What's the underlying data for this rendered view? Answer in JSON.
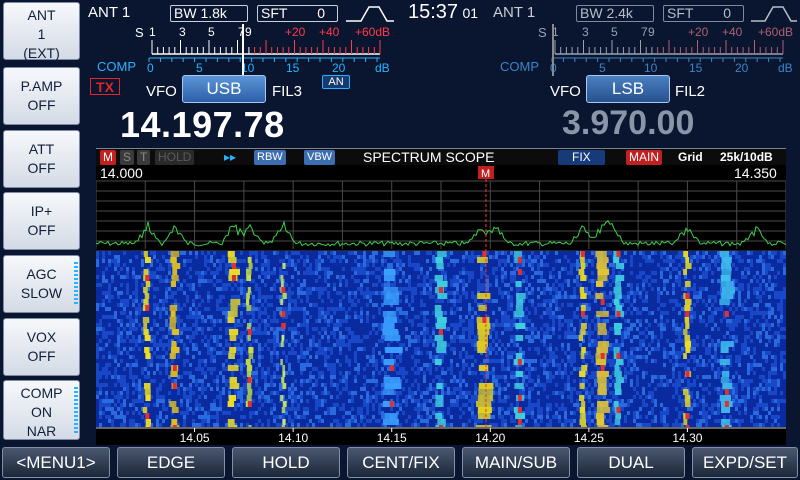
{
  "left_panel": [
    {
      "title": "ANT",
      "lines": [
        "1",
        "(EXT)"
      ],
      "name": "ant-button"
    },
    {
      "title": "P.AMP",
      "lines": [
        "OFF"
      ],
      "name": "pamp-button"
    },
    {
      "title": "ATT",
      "lines": [
        "OFF"
      ],
      "name": "att-button"
    },
    {
      "title": "IP+",
      "lines": [
        "OFF"
      ],
      "name": "ipplus-button"
    },
    {
      "title": "AGC",
      "lines": [
        "SLOW"
      ],
      "name": "agc-button"
    },
    {
      "title": "VOX",
      "lines": [
        "OFF"
      ],
      "name": "vox-button"
    },
    {
      "title": "COMP",
      "lines": [
        "ON",
        "NAR"
      ],
      "name": "comp-button"
    }
  ],
  "main": {
    "ant": "ANT 1",
    "bw_label": "BW",
    "bw_value": "1.8k",
    "sft_label": "SFT",
    "sft_value": "0",
    "s_label": "S",
    "s_ticks": [
      "1",
      "3",
      "5",
      "7",
      "9",
      "+20",
      "+40",
      "+60dB"
    ],
    "comp_label": "COMP",
    "comp_ticks": [
      "0",
      "5",
      "10",
      "15",
      "20",
      "dB"
    ],
    "an_badge": "AN",
    "tx_badge": "TX",
    "vfo_label": "VFO",
    "mode": "USB",
    "filter": "FIL3",
    "frequency": "14.197.78"
  },
  "clock": {
    "time": "15:37",
    "seconds": "01"
  },
  "sub": {
    "ant": "ANT 1",
    "bw_label": "BW",
    "bw_value": "2.4k",
    "sft_label": "SFT",
    "sft_value": "0",
    "s_label": "S",
    "s_ticks": [
      "1",
      "3",
      "5",
      "7",
      "9",
      "+20",
      "+40",
      "+60dB"
    ],
    "comp_label": "COMP",
    "comp_ticks": [
      "0",
      "5",
      "10",
      "15",
      "20",
      "dB"
    ],
    "vfo_label": "VFO",
    "mode": "LSB",
    "filter": "FIL2",
    "frequency": "3.970.00"
  },
  "scope": {
    "marker_m": "M",
    "s_tag": "S",
    "t_tag": "T",
    "hold": "HOLD",
    "arrows": "▸▸",
    "rbw": "RBW",
    "vbw": "VBW",
    "title": "SPECTRUM SCOPE",
    "fix": "FIX",
    "main": "MAIN",
    "grid": "Grid",
    "span": "25k/10dB",
    "left_freq": "14.000",
    "right_freq": "14.350",
    "center_marker": "M",
    "axis": [
      "14.05",
      "14.10",
      "14.15",
      "14.20",
      "14.25",
      "14.30"
    ],
    "peak_freqs_mhz": [
      14.026,
      14.04,
      14.07,
      14.078,
      14.095,
      14.195,
      14.203,
      14.247,
      14.257,
      14.262,
      14.3,
      14.335
    ]
  },
  "bottom_bar": [
    {
      "label": "<MENU1>",
      "name": "menu1-button"
    },
    {
      "label": "EDGE",
      "name": "edge-button"
    },
    {
      "label": "HOLD",
      "name": "hold-button"
    },
    {
      "label": "CENT/FIX",
      "name": "cent-fix-button"
    },
    {
      "label": "MAIN/SUB",
      "name": "main-sub-button"
    },
    {
      "label": "DUAL",
      "name": "dual-button"
    },
    {
      "label": "EXPD/SET",
      "name": "expd-set-button"
    }
  ],
  "colors": {
    "accent": "#26b4ff",
    "tx": "#e0262a",
    "sub_freq": "#8a96a8"
  }
}
